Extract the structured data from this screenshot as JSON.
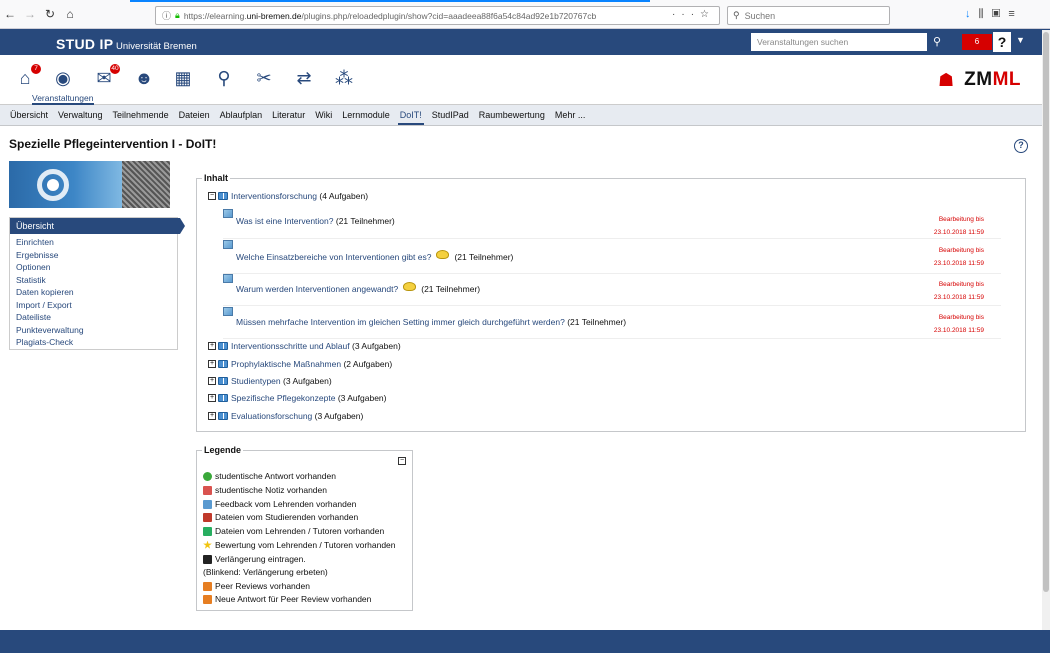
{
  "browser": {
    "url_prefix": "https://elearning.",
    "url_domain": "uni-bremen.de",
    "url_rest": "/plugins.php/reloadedplugin/show?cid=aaadeea88f6a54c84ad92e1b720767cb",
    "search_placeholder": "Suchen"
  },
  "topbar": {
    "brand": "STUD IP",
    "university": "Universität Bremen",
    "search_placeholder": "Veranstaltungen suchen",
    "notification_count": "6"
  },
  "iconnav": {
    "items": [
      {
        "name": "home-icon",
        "glyph": "⌂",
        "badge": "7"
      },
      {
        "name": "courses-icon",
        "glyph": "◉",
        "badge": ""
      },
      {
        "name": "messages-icon",
        "glyph": "✉",
        "badge": "40"
      },
      {
        "name": "community-icon",
        "glyph": "☻",
        "badge": ""
      },
      {
        "name": "calendar-icon",
        "glyph": "▦",
        "badge": ""
      },
      {
        "name": "search-icon",
        "glyph": "⚲",
        "badge": ""
      },
      {
        "name": "tools-icon",
        "glyph": "✂",
        "badge": ""
      },
      {
        "name": "sync-icon",
        "glyph": "⇄",
        "badge": ""
      },
      {
        "name": "network-icon",
        "glyph": "⁂",
        "badge": ""
      }
    ],
    "active_label": "Veranstaltungen",
    "logo_text_a": "ZM",
    "logo_text_b": "ML"
  },
  "tabs": [
    {
      "label": "Übersicht",
      "active": false
    },
    {
      "label": "Verwaltung",
      "active": false
    },
    {
      "label": "Teilnehmende",
      "active": false
    },
    {
      "label": "Dateien",
      "active": false
    },
    {
      "label": "Ablaufplan",
      "active": false
    },
    {
      "label": "Literatur",
      "active": false
    },
    {
      "label": "Wiki",
      "active": false
    },
    {
      "label": "Lernmodule",
      "active": false
    },
    {
      "label": "DoIT!",
      "active": true
    },
    {
      "label": "StudIPad",
      "active": false
    },
    {
      "label": "Raumbewertung",
      "active": false
    },
    {
      "label": "Mehr ...",
      "active": false
    }
  ],
  "page_title": "Spezielle Pflegeintervention I - DoIT!",
  "help_label": "?",
  "sidebar": {
    "header": "Übersicht",
    "items": [
      "Einrichten",
      "Ergebnisse",
      "Optionen",
      "Statistik",
      "Daten kopieren",
      "Import / Export",
      "Dateiliste",
      "Punkteverwaltung",
      "Plagiats-Check"
    ]
  },
  "content": {
    "legend": "Inhalt",
    "expanded_group": {
      "title": "Interventionsforschung",
      "count": "(4 Aufgaben)"
    },
    "tasks": [
      {
        "title": "Was ist eine Intervention?",
        "participants": "(21 Teilnehmer)",
        "smiley": false,
        "deadline_label": "Bearbeitung bis",
        "deadline": "23.10.2018 11:59"
      },
      {
        "title": "Welche Einsatzbereiche von Interventionen gibt es?",
        "participants": "(21 Teilnehmer)",
        "smiley": true,
        "deadline_label": "Bearbeitung bis",
        "deadline": "23.10.2018 11:59"
      },
      {
        "title": "Warum werden Interventionen angewandt?",
        "participants": "(21 Teilnehmer)",
        "smiley": true,
        "deadline_label": "Bearbeitung bis",
        "deadline": "23.10.2018 11:59"
      },
      {
        "title": "Müssen mehrfache Intervention im gleichen Setting immer gleich durchgeführt werden?",
        "participants": "(21 Teilnehmer)",
        "smiley": false,
        "deadline_label": "Bearbeitung bis",
        "deadline": "23.10.2018 11:59"
      }
    ],
    "collapsed_groups": [
      {
        "title": "Interventionsschritte und Ablauf",
        "count": "(3 Aufgaben)"
      },
      {
        "title": "Prophylaktische Maßnahmen",
        "count": "(2 Aufgaben)"
      },
      {
        "title": "Studientypen",
        "count": "(3 Aufgaben)"
      },
      {
        "title": "Spezifische Pflegekonzepte",
        "count": "(3 Aufgaben)"
      },
      {
        "title": "Evaluationsforschung",
        "count": "(3 Aufgaben)"
      }
    ]
  },
  "legend_box": {
    "legend": "Legende",
    "items": [
      {
        "text": "studentische Antwort vorhanden",
        "icon": "check-icon",
        "color": "#3aa83a"
      },
      {
        "text": "studentische Notiz vorhanden",
        "icon": "note-icon",
        "color": "#d9534f"
      },
      {
        "text": "Feedback vom Lehrenden vorhanden",
        "icon": "feedback-icon",
        "color": "#5a9ad0"
      },
      {
        "text": "Dateien vom Studierenden vorhanden",
        "icon": "student-file-icon",
        "color": "#c0392b"
      },
      {
        "text": "Dateien vom Lehrenden / Tutoren vorhanden",
        "icon": "teacher-file-icon",
        "color": "#27ae60"
      },
      {
        "text": "Bewertung vom Lehrenden / Tutoren vorhanden",
        "icon": "star-icon",
        "color": "#f1c40f"
      },
      {
        "text": "Verlängerung eintragen.",
        "icon": "extension-icon",
        "color": "#222222"
      },
      {
        "text": "(Blinkend: Verlängerung erbeten)",
        "icon": "",
        "color": ""
      },
      {
        "text": "Peer Reviews vorhanden",
        "icon": "peer-review-icon",
        "color": "#e67e22"
      },
      {
        "text": "Neue Antwort für Peer Review vorhanden",
        "icon": "peer-answer-icon",
        "color": "#e67e22"
      }
    ]
  }
}
